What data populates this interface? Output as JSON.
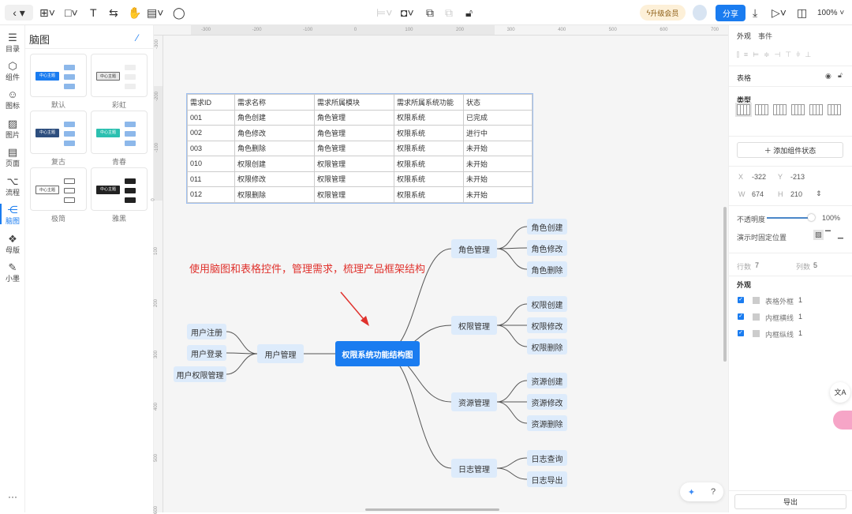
{
  "toolbar": {
    "icons": [
      "back-icon",
      "dropdown-icon",
      "insert-icon",
      "shape-icon",
      "text-icon",
      "connector-icon",
      "hand-icon",
      "note-icon",
      "comment-icon",
      "align-icon",
      "arrange-icon",
      "group-icon",
      "ungroup-icon",
      "lock-icon"
    ],
    "upgrade": "升级会员",
    "share": "分享",
    "zoom": "100%"
  },
  "iconbar": [
    {
      "label": "目录",
      "icon": "list-icon",
      "glyph": "☰"
    },
    {
      "label": "组件",
      "icon": "component-icon",
      "glyph": "⬡"
    },
    {
      "label": "图标",
      "icon": "smiley-icon",
      "glyph": "☺"
    },
    {
      "label": "图片",
      "icon": "image-icon",
      "glyph": "▨"
    },
    {
      "label": "页面",
      "icon": "page-icon",
      "glyph": "▤"
    },
    {
      "label": "流程",
      "icon": "flow-icon",
      "glyph": "⌥"
    },
    {
      "label": "脑图",
      "icon": "mindmap-icon",
      "glyph": "⋲",
      "active": true
    },
    {
      "label": "母版",
      "icon": "master-icon",
      "glyph": "❖"
    },
    {
      "label": "小墨",
      "icon": "magic-wand-icon",
      "glyph": "✎"
    }
  ],
  "more": "···",
  "panel": {
    "title": "脑图",
    "themes": [
      {
        "label": "默认",
        "center": "中心主题",
        "color": "#1a7cf0"
      },
      {
        "label": "彩虹",
        "center": "中心主题",
        "color": "#e8e8e8"
      },
      {
        "label": "复古",
        "center": "中心主题",
        "color": "#2d4e7e"
      },
      {
        "label": "青春",
        "center": "中心主题",
        "color": "#2cc0b0"
      },
      {
        "label": "极简",
        "center": "中心主题",
        "color": "#ffffff"
      },
      {
        "label": "雅黑",
        "center": "中心主题",
        "color": "#222222"
      }
    ]
  },
  "rulers": {
    "top": [
      "-300",
      "-200",
      "-100",
      "0",
      "100",
      "200",
      "300",
      "400",
      "500",
      "600",
      "700"
    ],
    "left": [
      "-300",
      "-200",
      "-100",
      "0",
      "100",
      "200",
      "300",
      "400",
      "500",
      "600"
    ]
  },
  "table": {
    "header": [
      "需求ID",
      "需求名称",
      "需求所属模块",
      "需求所属系统功能",
      "状态"
    ],
    "rows": [
      [
        "001",
        "角色创建",
        "角色管理",
        "权限系统",
        "已完成"
      ],
      [
        "002",
        "角色修改",
        "角色管理",
        "权限系统",
        "进行中"
      ],
      [
        "003",
        "角色删除",
        "角色管理",
        "权限系统",
        "未开始"
      ],
      [
        "010",
        "权限创建",
        "权限管理",
        "权限系统",
        "未开始"
      ],
      [
        "011",
        "权限修改",
        "权限管理",
        "权限系统",
        "未开始"
      ],
      [
        "012",
        "权限删除",
        "权限管理",
        "权限系统",
        "未开始"
      ]
    ]
  },
  "note": "使用脑图和表格控件，管理需求，梳理产品框架结构",
  "mindmap": {
    "center": "权限系统功能结构图",
    "left": {
      "label": "用户管理",
      "children": [
        "用户注册",
        "用户登录",
        "用户权限管理"
      ]
    },
    "right": [
      {
        "label": "角色管理",
        "children": [
          "角色创建",
          "角色修改",
          "角色删除"
        ]
      },
      {
        "label": "权限管理",
        "children": [
          "权限创建",
          "权限修改",
          "权限删除"
        ]
      },
      {
        "label": "资源管理",
        "children": [
          "资源创建",
          "资源修改",
          "资源删除"
        ]
      },
      {
        "label": "日志管理",
        "children": [
          "日志查询",
          "日志导出"
        ]
      }
    ]
  },
  "right": {
    "tabs": [
      "外观",
      "事件"
    ],
    "component": "表格",
    "type_label": "类型",
    "add_state": "添加组件状态",
    "x_label": "X",
    "x": "-322",
    "y_label": "Y",
    "y": "-213",
    "w_label": "W",
    "w": "674",
    "h_label": "H",
    "h": "210",
    "opacity_label": "不透明度",
    "opacity": "100%",
    "opacity_value": 100,
    "fixed_label": "演示时固定位置",
    "rows_label": "行数",
    "rows": "7",
    "cols_label": "列数",
    "cols": "5",
    "appearance": "外观",
    "borders": [
      {
        "label": "表格外框",
        "value": "1",
        "checked": true
      },
      {
        "label": "内框横线",
        "value": "1",
        "checked": true
      },
      {
        "label": "内框纵线",
        "value": "1",
        "checked": true
      }
    ],
    "export": "导出"
  },
  "colors": {
    "accent": "#1a7cf0",
    "note": "#e0322d",
    "node": "#ddebfb"
  }
}
